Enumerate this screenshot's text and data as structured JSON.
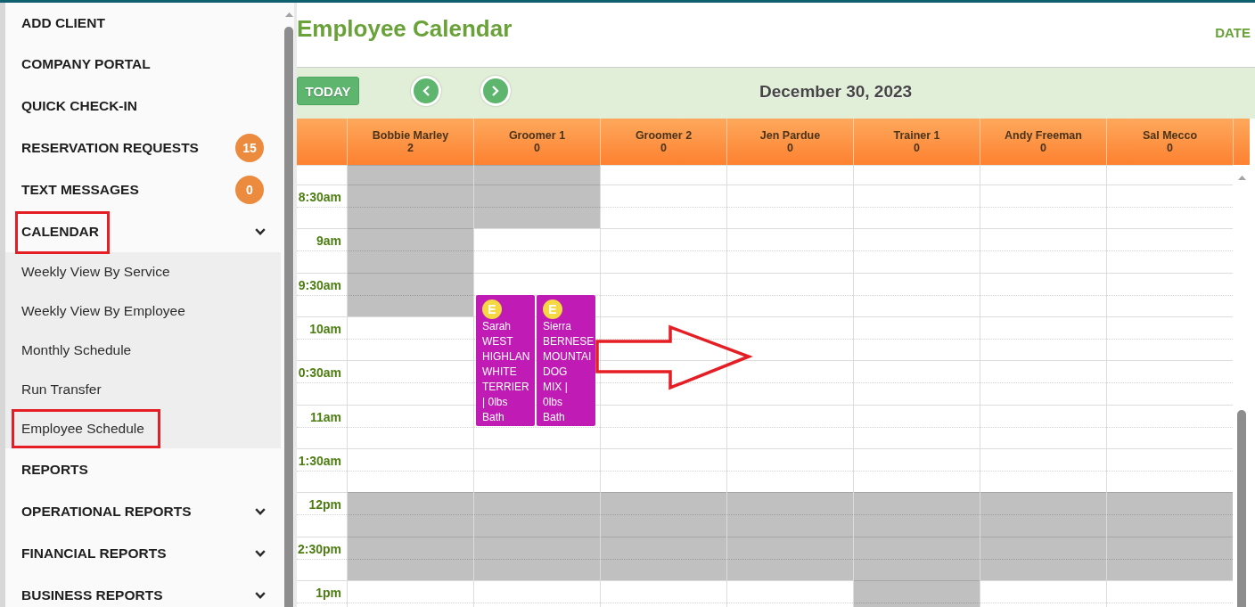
{
  "sidebar": {
    "items": [
      {
        "kind": "link",
        "label": "ADD CLIENT",
        "highlighted": false
      },
      {
        "kind": "link",
        "label": "COMPANY PORTAL",
        "highlighted": false
      },
      {
        "kind": "link",
        "label": "QUICK CHECK-IN",
        "highlighted": false
      },
      {
        "kind": "link",
        "label": "RESERVATION REQUESTS",
        "badge": "15",
        "highlighted": false
      },
      {
        "kind": "link",
        "label": "TEXT MESSAGES",
        "badge": "0",
        "highlighted": false
      },
      {
        "kind": "group",
        "label": "CALENDAR",
        "expanded": true,
        "highlighted": true,
        "children": [
          {
            "label": "Weekly View By Service",
            "highlighted": false
          },
          {
            "label": "Weekly View By Employee",
            "highlighted": false
          },
          {
            "label": "Monthly Schedule",
            "highlighted": false
          },
          {
            "label": "Run Transfer",
            "highlighted": false
          },
          {
            "label": "Employee Schedule",
            "highlighted": true
          }
        ]
      },
      {
        "kind": "link",
        "label": "REPORTS",
        "highlighted": false
      },
      {
        "kind": "group",
        "label": "OPERATIONAL REPORTS",
        "expanded": false,
        "highlighted": false
      },
      {
        "kind": "group",
        "label": "FINANCIAL REPORTS",
        "expanded": false,
        "highlighted": false
      },
      {
        "kind": "group",
        "label": "BUSINESS REPORTS",
        "expanded": false,
        "highlighted": false
      }
    ]
  },
  "header": {
    "title": "Employee Calendar",
    "date_link": "DATE"
  },
  "toolbar": {
    "today_button": "TODAY",
    "date": "December 30, 2023"
  },
  "calendar": {
    "time_labels": [
      "8:30am",
      "9am",
      "9:30am",
      "10am",
      "0:30am",
      "11am",
      "1:30am",
      "12pm",
      "2:30pm",
      "1pm"
    ],
    "columns": [
      {
        "name": "Bobbie Marley",
        "count": "2",
        "slots": [
          {
            "blocked": true
          },
          {
            "blocked": true
          },
          {
            "blocked": true
          },
          {
            "blocked": true
          },
          {
            "blocked": false
          },
          {
            "blocked": false
          },
          {
            "blocked": false
          },
          {
            "blocked": false
          },
          {
            "blocked": true
          },
          {
            "blocked": true
          },
          {
            "blocked": false
          }
        ]
      },
      {
        "name": "Groomer 1",
        "count": "0",
        "slots": [
          {
            "blocked": true
          },
          {
            "blocked": true
          },
          {
            "blocked": false
          },
          {
            "blocked": false,
            "appointments": [
              {
                "badge": "E",
                "lines": [
                  "Sarah",
                  "WEST",
                  "HIGHLAN",
                  "WHITE",
                  "TERRIER",
                  "| 0lbs",
                  "Bath"
                ]
              },
              {
                "badge": "E",
                "lines": [
                  "Sierra",
                  "BERNESE",
                  "MOUNTAI",
                  "DOG",
                  "MIX |",
                  "0lbs",
                  "Bath"
                ]
              }
            ]
          },
          {
            "blocked": false
          },
          {
            "blocked": false
          },
          {
            "blocked": false
          },
          {
            "blocked": false
          },
          {
            "blocked": true
          },
          {
            "blocked": true
          },
          {
            "blocked": false
          }
        ]
      },
      {
        "name": "Groomer 2",
        "count": "0",
        "slots": [
          {
            "blocked": false
          },
          {
            "blocked": false
          },
          {
            "blocked": false
          },
          {
            "blocked": false
          },
          {
            "blocked": false
          },
          {
            "blocked": false
          },
          {
            "blocked": false
          },
          {
            "blocked": false
          },
          {
            "blocked": true
          },
          {
            "blocked": true
          },
          {
            "blocked": false
          }
        ]
      },
      {
        "name": "Jen Pardue",
        "count": "0",
        "slots": [
          {
            "blocked": false
          },
          {
            "blocked": false
          },
          {
            "blocked": false
          },
          {
            "blocked": false
          },
          {
            "blocked": false
          },
          {
            "blocked": false
          },
          {
            "blocked": false
          },
          {
            "blocked": false
          },
          {
            "blocked": true
          },
          {
            "blocked": true
          },
          {
            "blocked": false
          }
        ]
      },
      {
        "name": "Trainer 1",
        "count": "0",
        "slots": [
          {
            "blocked": false
          },
          {
            "blocked": false
          },
          {
            "blocked": false
          },
          {
            "blocked": false
          },
          {
            "blocked": false
          },
          {
            "blocked": false
          },
          {
            "blocked": false
          },
          {
            "blocked": false
          },
          {
            "blocked": true
          },
          {
            "blocked": true
          },
          {
            "blocked": true
          }
        ]
      },
      {
        "name": "Andy Freeman",
        "count": "0",
        "slots": [
          {
            "blocked": false
          },
          {
            "blocked": false
          },
          {
            "blocked": false
          },
          {
            "blocked": false
          },
          {
            "blocked": false
          },
          {
            "blocked": false
          },
          {
            "blocked": false
          },
          {
            "blocked": false
          },
          {
            "blocked": true
          },
          {
            "blocked": true
          },
          {
            "blocked": false
          }
        ]
      },
      {
        "name": "Sal Mecco",
        "count": "0",
        "slots": [
          {
            "blocked": false
          },
          {
            "blocked": false
          },
          {
            "blocked": false
          },
          {
            "blocked": false
          },
          {
            "blocked": false
          },
          {
            "blocked": false
          },
          {
            "blocked": false
          },
          {
            "blocked": false
          },
          {
            "blocked": true
          },
          {
            "blocked": true
          },
          {
            "blocked": false
          }
        ]
      }
    ],
    "annotations": [
      {
        "kind": "arrow"
      }
    ]
  }
}
